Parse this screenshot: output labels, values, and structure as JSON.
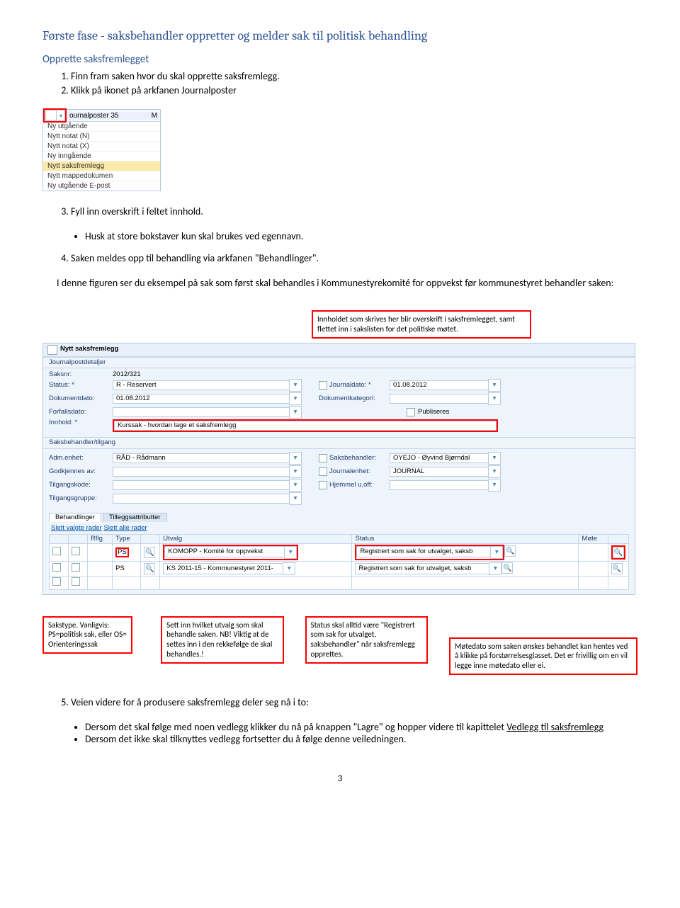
{
  "heading": "Første fase - saksbehandler oppretter og melder sak til politisk behandling",
  "subheading": "Opprette saksfremlegget",
  "steps12": {
    "s1": "Finn fram saken hvor du skal opprette saksfremlegg.",
    "s2": "Klikk på ikonet på arkfanen Journalposter"
  },
  "dropdown": {
    "title": "ournalposter 35",
    "trailing": "M",
    "items": [
      "Ny utgående",
      "Nytt notat (N)",
      "Nytt notat (X)",
      "Ny inngående",
      "Nytt saksfremlegg",
      "Nytt mappedokumen",
      "Ny utgående E-post"
    ]
  },
  "steps34": {
    "s3": "Fyll inn overskrift i feltet innhold.",
    "s3b": "Husk at store bokstaver kun skal brukes ved egennavn.",
    "s4": "Saken meldes opp til behandling via arkfanen \"Behandlinger\".",
    "para": "I denne figuren ser du eksempel på sak som først skal behandles i Kommunestyrekomité for oppvekst før kommunestyret behandler saken:"
  },
  "callout_top": "Innholdet som skrives her blir overskrift i saksfremlegget, samt flettet inn i sakslisten for det politiske møtet.",
  "form": {
    "title": "Nytt saksfremlegg",
    "sec1": "Journalpostdetaljer",
    "lab_sak": "Saksnr:",
    "val_sak": "2012/321",
    "lab_status": "Status: *",
    "val_status": "R - Reservert",
    "lab_jdato": "Journaldato: *",
    "val_jdato": "01.08.2012",
    "lab_ddato": "Dokumentdato:",
    "val_ddato": "01.08.2012",
    "lab_dkat": "Dokumentkategori:",
    "lab_fdato": "Forfallsdato:",
    "lab_pub": "Publiseres",
    "lab_inn": "Innhold: *",
    "val_inn": "Kurssak - hvordan lage et saksfremlegg",
    "sec2": "Saksbehandler/tilgang",
    "lab_adm": "Adm.enhet:",
    "val_adm": "RÅD - Rådmann",
    "lab_sbeh": "Saksbehandler:",
    "val_sbeh": "OYEJO - Øyvind Bjørndal",
    "lab_godk": "Godkjennes av:",
    "lab_jenh": "Journalenhet:",
    "val_jenh": "JOURNAL",
    "lab_tkode": "Tilgangskode:",
    "lab_hj": "Hjemmel u.off:",
    "lab_tgrp": "Tilgangsgruppe:",
    "tab1": "Behandlinger",
    "tab2": "Tilleggsattributter",
    "gridhead_a": "Slett valgte rader",
    "gridhead_b": "Slett alle rader",
    "col_rflg": "Rflg",
    "col_type": "Type",
    "col_utvalg": "Utvalg",
    "col_status": "Status",
    "col_mote": "Møte",
    "row0": {
      "type": "PS",
      "utvalg": "KOMOPP - Komité for oppvekst",
      "status": "Registrert som sak for utvalget, saksb"
    },
    "row1": {
      "type": "PS",
      "utvalg": "KS 2011-15 - Kommunestyret 2011-",
      "status": "Registrert som sak for utvalget, saksb"
    }
  },
  "callouts_bottom": {
    "c1": "Sakstype. Vanligvis: PS=politisk sak, eller OS= Orienteringssak",
    "c2": "Sett inn hvilket utvalg som skal behandle saken. NB! Viktig at de settes inn i den rekkefølge de skal behandles.!",
    "c3": "Status skal alltid være \"Registrert som sak for utvalget, saksbehandler\" når saksfremlegg opprettes.",
    "c4": "Møtedato som saken ønskes behandlet kan hentes ved å klikke på forstørrelsesglasset. Det er frivillig om en vil legge inne møtedato eller ei."
  },
  "step5": {
    "s5": "Veien videre for å produsere saksfremlegg deler seg nå i to:",
    "b1a": "Dersom det skal følge med noen vedlegg klikker du nå på knappen \"Lagre\" og hopper videre til kapittelet ",
    "b1link": "Vedlegg til saksfremlegg",
    "b2": "Dersom det ikke skal tilknyttes vedlegg fortsetter du å følge denne veiledningen."
  },
  "pagenum": "3"
}
